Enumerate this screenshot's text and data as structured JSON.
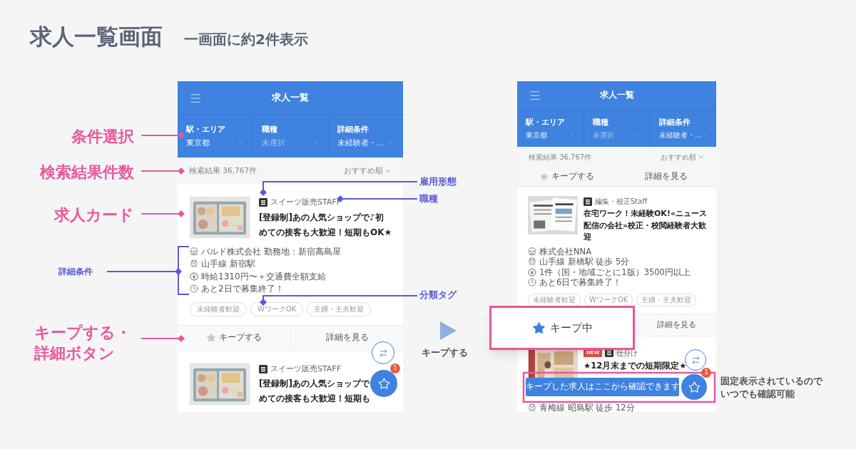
{
  "heading": {
    "title": "求人一覧画面",
    "subtitle": "一画面に約2件表示"
  },
  "screens": [
    {
      "header_title": "求人一覧",
      "filters": [
        {
          "label": "駅・エリア",
          "value": "東京都",
          "chosen": true
        },
        {
          "label": "職種",
          "value": "未選択",
          "chosen": false
        },
        {
          "label": "詳細条件",
          "value": "未経験者・...",
          "chosen": true
        }
      ],
      "result_count": "検索結果 36,767件",
      "sort": "おすすめ順",
      "cards": [
        {
          "badges": [
            {
              "kind": "type"
            }
          ],
          "category": "スイーツ販売STAFF",
          "title_lines": [
            "[登録制]あの人気ショップで♪初",
            "めての接客も大歓迎！短期もOK★"
          ],
          "details": [
            {
              "kind": "company",
              "text": "バルド株式会社 勤務地：新宿高島屋"
            },
            {
              "kind": "train",
              "text": "山手線 新宿駅"
            },
            {
              "kind": "pay",
              "text": "時給1310円〜＋交通費全額支給"
            },
            {
              "kind": "deadline",
              "text": "あと2日で募集終了！"
            }
          ],
          "tags": [
            "未経験者歓迎",
            "WワークOK",
            "主婦・主夫歓迎"
          ],
          "actions": {
            "keep_label": "キープする",
            "kept": false,
            "highlighted": false,
            "detail_label": "詳細を見る"
          }
        },
        {
          "badges": [
            {
              "kind": "type"
            }
          ],
          "category": "スイーツ販売STAFF",
          "title_lines": [
            "[登録制]あの人気ショップで",
            "めての接客も大歓迎！短期も"
          ]
        }
      ],
      "keep_badge": "1"
    },
    {
      "header_title": "求人一覧",
      "filters": [
        {
          "label": "駅・エリア",
          "value": "東京都",
          "chosen": true
        },
        {
          "label": "職種",
          "value": "未選択",
          "chosen": false
        },
        {
          "label": "詳細条件",
          "value": "未経験者・...",
          "chosen": true
        }
      ],
      "result_count": "検索結果 36,767件",
      "sort": "おすすめ順",
      "top_actions": {
        "keep_label": "キープする",
        "kept": false,
        "detail_label": "詳細を見る"
      },
      "cards": [
        {
          "badges": [
            {
              "kind": "type"
            }
          ],
          "category": "編集・校正Staff",
          "title_lines": [
            "在宅ワーク！未経験OK!«ニュース",
            "配信の会社»校正・校閲経験者大歓",
            "迎"
          ],
          "details": [
            {
              "kind": "company",
              "text": "株式会社NNA"
            },
            {
              "kind": "train",
              "text": "山手線 新橋駅 徒歩 5分"
            },
            {
              "kind": "pay",
              "text": "1件（国・地域ごとに1版）3500円以上"
            },
            {
              "kind": "deadline",
              "text": "あと6日で募集終了！"
            }
          ],
          "tags": [
            "未経験者歓迎",
            "WワークOK",
            "主婦・主夫歓迎"
          ],
          "actions": {
            "keep_label": "キープ中",
            "kept": true,
            "highlighted": true,
            "detail_label": "詳細を見る"
          }
        },
        {
          "badges": [
            {
              "kind": "new",
              "text": "NEW"
            },
            {
              "kind": "type"
            }
          ],
          "category": "仕分け",
          "title_lines": [
            "★12月末までの短期限定★"
          ],
          "details": [
            {
              "kind": "train",
              "text": "青梅線 昭島駅 徒歩 12分"
            }
          ]
        }
      ],
      "keep_badge": "1",
      "tooltip": "キープした求人はここから確認できます"
    }
  ],
  "annotations": [
    {
      "kind": "major",
      "lines": [
        "条件選択"
      ]
    },
    {
      "kind": "major",
      "lines": [
        "検索結果件数"
      ]
    },
    {
      "kind": "major",
      "lines": [
        "求人カード"
      ]
    },
    {
      "kind": "minor",
      "lines": [
        "詳細条件"
      ]
    },
    {
      "kind": "major",
      "lines": [
        "キープする・",
        "詳細ボタン"
      ]
    },
    {
      "kind": "minor",
      "lines": [
        "雇用形態"
      ]
    },
    {
      "kind": "minor",
      "lines": [
        "職種"
      ]
    },
    {
      "kind": "minor",
      "lines": [
        "分類タグ"
      ]
    },
    {
      "kind": "flow",
      "lines": [
        "キープする"
      ]
    },
    {
      "kind": "note",
      "lines": [
        "固定表示されているので",
        "いつでも確認可能"
      ]
    }
  ]
}
